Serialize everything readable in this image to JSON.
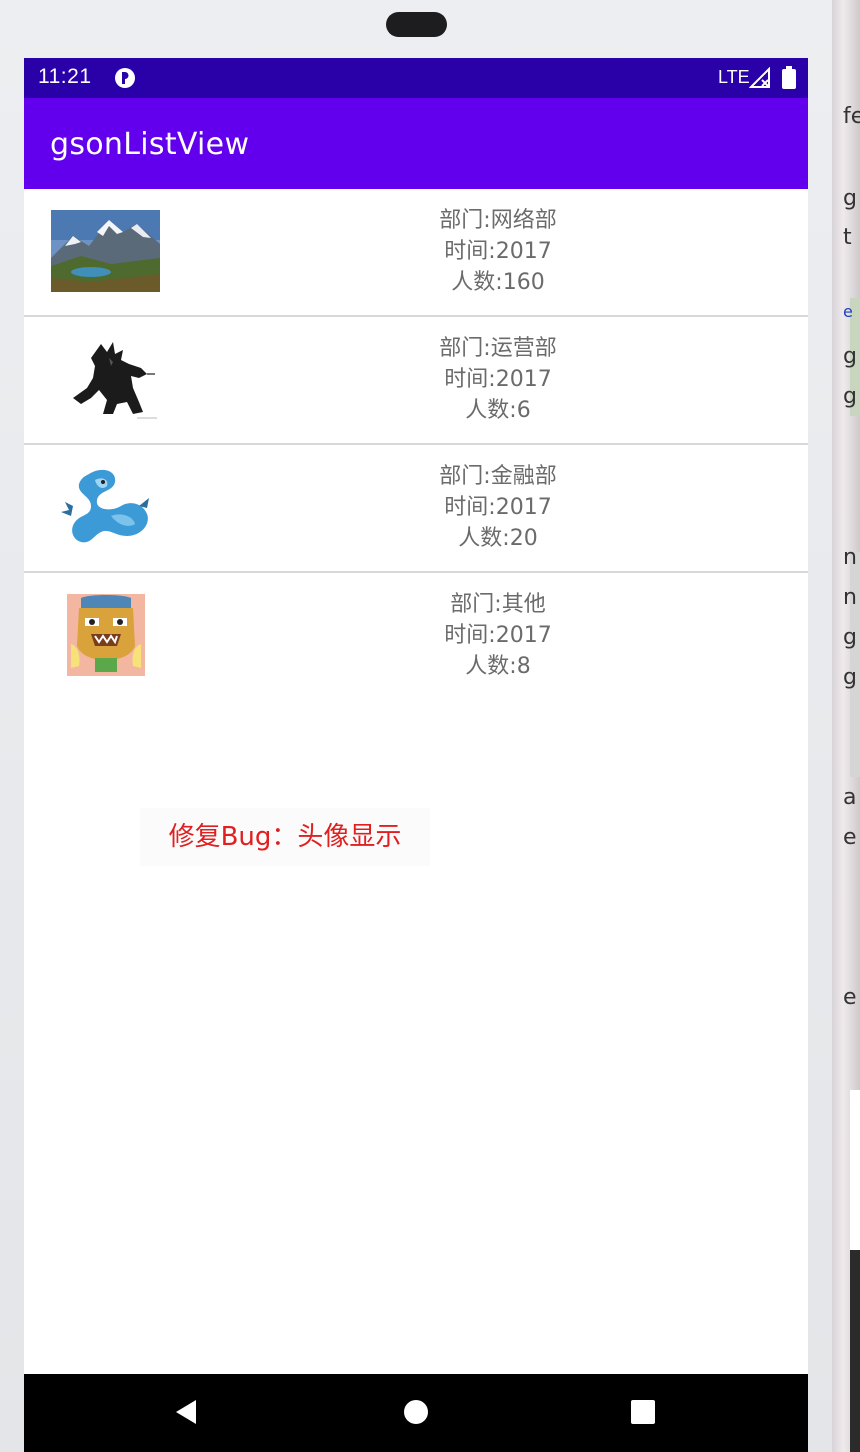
{
  "status_bar": {
    "time": "11:21",
    "network": "LTE"
  },
  "app_bar": {
    "title": "gsonListView"
  },
  "list": {
    "items": [
      {
        "department": "部门:网络部",
        "time": "时间:2017",
        "count": "人数:160",
        "avatar": "mountain-landscape"
      },
      {
        "department": "部门:运营部",
        "time": "时间:2017",
        "count": "人数:6",
        "avatar": "monster-figure"
      },
      {
        "department": "部门:金融部",
        "time": "时间:2017",
        "count": "人数:20",
        "avatar": "blue-dragon"
      },
      {
        "department": "部门:其他",
        "time": "时间:2017",
        "count": "人数:8",
        "avatar": "tribal-mask"
      }
    ]
  },
  "overlay_label": "修复Bug：头像显示",
  "side_text": [
    "fe",
    "g",
    "t",
    "e",
    "g",
    "g",
    "n",
    "n",
    "g",
    "g",
    "a",
    "e",
    "e"
  ],
  "colors": {
    "status_bar": "#2a00a8",
    "app_bar": "#6200ee",
    "overlay_text": "#e02020"
  }
}
